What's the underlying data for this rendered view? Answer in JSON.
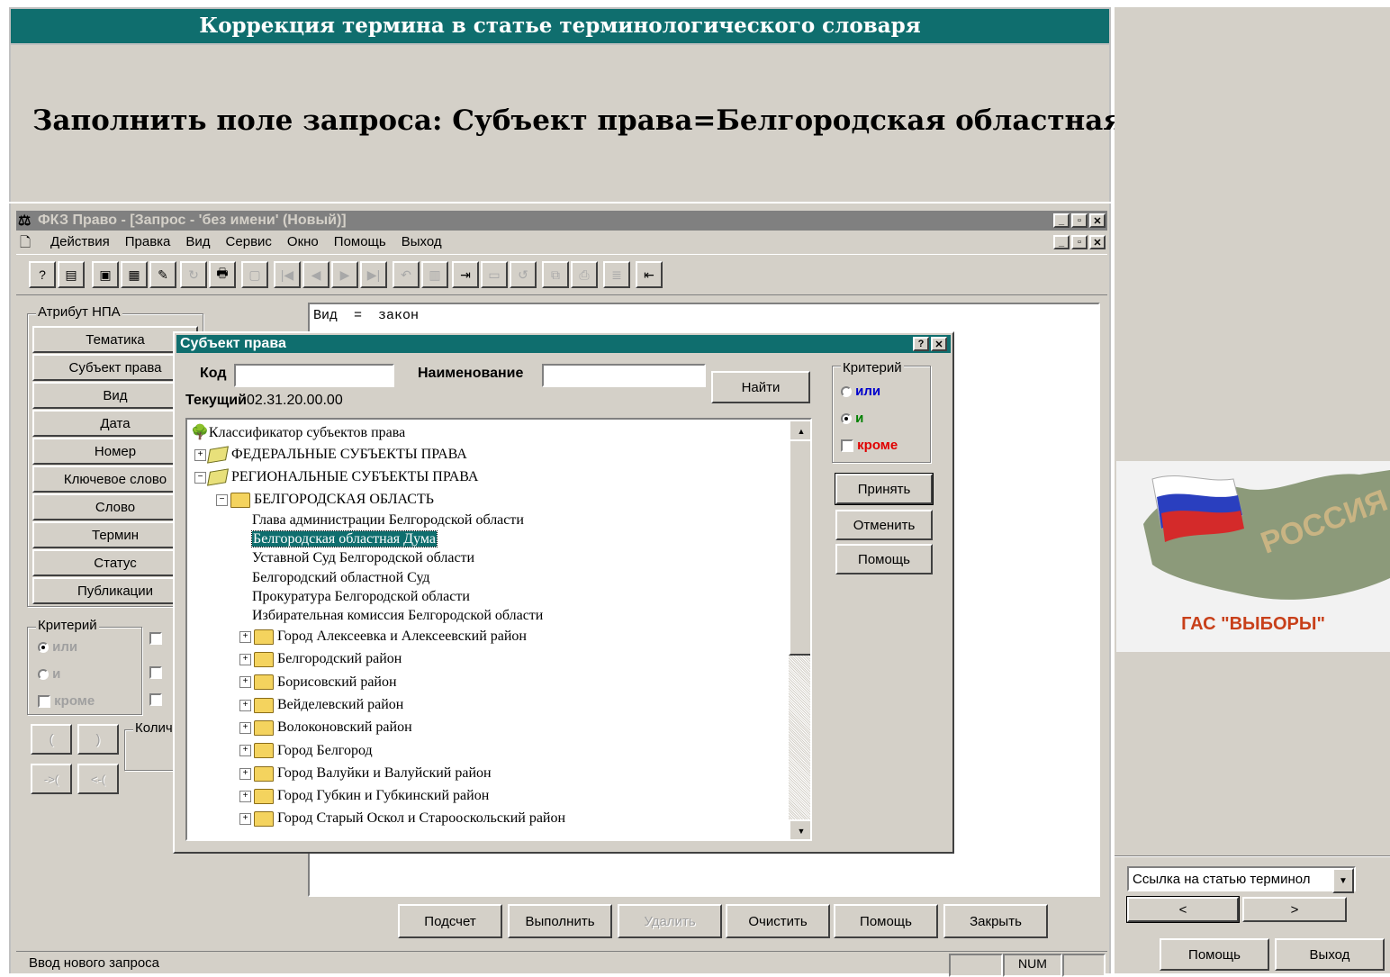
{
  "slide": {
    "header_title": "Коррекция термина в статье терминологического словаря",
    "instruction": "Заполнить поле запроса: Субъект права=Белгородская областная дума",
    "logo_text": "ГАС \"ВЫБОРЫ\"",
    "nav_select": "Ссылка на статью терминол",
    "nav_prev": "<",
    "nav_next": ">",
    "help_button": "Помощь",
    "exit_button": "Выход"
  },
  "app": {
    "window_title": "ФКЗ Право - [Запрос - 'без имени' (Новый)]",
    "menu": [
      "Действия",
      "Правка",
      "Вид",
      "Сервис",
      "Окно",
      "Помощь",
      "Выход"
    ],
    "attr_group_label": "Атрибут НПА",
    "attr_buttons": [
      "Тематика",
      "Субъект права",
      "Вид",
      "Дата",
      "Номер",
      "Ключевое слово",
      "Слово",
      "Термин",
      "Статус",
      "Публикации"
    ],
    "criteria_label": "Критерий",
    "crit_or": "или",
    "crit_and": "и",
    "crit_except": "кроме",
    "count_label": "Колич",
    "paren_open": "(",
    "paren_close": ")",
    "arrow_in": "->(",
    "arrow_out": "<-(",
    "query_text": "Вид  =  закон",
    "bottom_buttons": [
      "Подсчет",
      "Выполнить",
      "Удалить",
      "Очистить",
      "Помощь",
      "Закрыть"
    ],
    "status_text": "Ввод нового запроса",
    "status_num": "NUM"
  },
  "dialog": {
    "title": "Субъект права",
    "code_label": "Код",
    "code_value": "",
    "name_label": "Наименование",
    "name_value": "",
    "find_button": "Найти",
    "current_label": "Текущий",
    "current_value": "02.31.20.00.00",
    "criteria_label": "Критерий",
    "crit_or": "или",
    "crit_and": "и",
    "crit_except": "кроме",
    "accept_button": "Принять",
    "cancel_button": "Отменить",
    "help_button": "Помощь",
    "tree": {
      "root": "Классификатор субъектов права",
      "federal": "ФЕДЕРАЛЬНЫЕ СУБЪЕКТЫ ПРАВА",
      "regional": "РЕГИОНАЛЬНЫЕ СУБЪЕКТЫ ПРАВА",
      "region": "БЕЛГОРОДСКАЯ ОБЛАСТЬ",
      "leaves": [
        "Глава администрации Белгородской области",
        "Белгородская областная Дума",
        "Уставной Суд Белгородской области",
        "Белгородский областной Суд",
        "Прокуратура Белгородской области",
        "Избирательная комиссия Белгородской области"
      ],
      "folders": [
        "Город Алексеевка и Алексеевский район",
        "Белгородский район",
        "Борисовский район",
        "Вейделевский район",
        "Волоконовский район",
        "Город Белгород",
        "Город Валуйки и Валуйский район",
        "Город Губкин и Губкинский район",
        "Город Старый Оскол и Старооскольский район"
      ]
    }
  },
  "colors": {
    "teal": "#0f6e6e",
    "window_grey": "#d4d0c8",
    "selection": "#0f6e6e",
    "or_blue": "#0000cc",
    "and_green": "#008000",
    "except_red": "#e00000",
    "logo_red": "#c8401a"
  }
}
